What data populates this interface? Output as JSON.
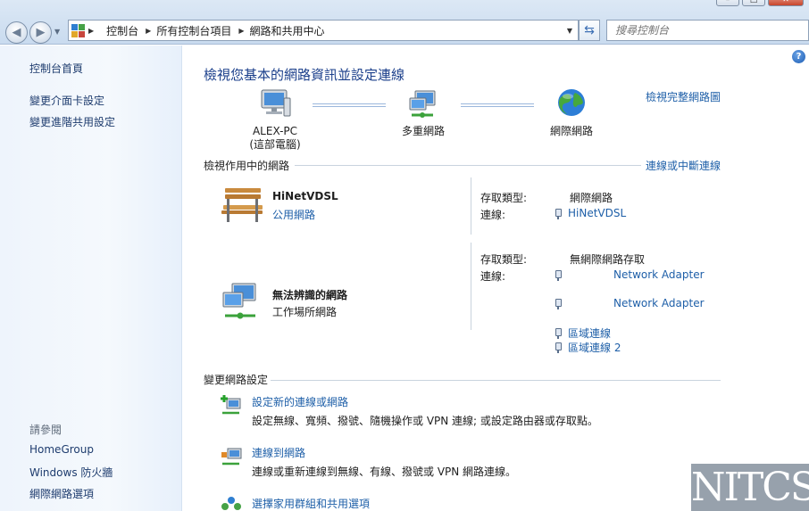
{
  "window": {
    "controls": [
      "–",
      "□",
      "✕"
    ]
  },
  "nav": {
    "back_icon": "back-arrow-icon",
    "forward_icon": "forward-arrow-icon"
  },
  "address": {
    "crumbs": [
      "控制台",
      "所有控制台項目",
      "網路和共用中心"
    ]
  },
  "search": {
    "placeholder": "搜尋控制台"
  },
  "sidebar": {
    "home": "控制台首頁",
    "items": [
      "變更介面卡設定",
      "變更進階共用設定"
    ],
    "see_also_label": "請參閱",
    "see_also": [
      "HomeGroup",
      "Windows 防火牆",
      "網際網路選項"
    ]
  },
  "main": {
    "title": "檢視您基本的網路資訊並設定連線",
    "view_full_map": "檢視完整網路圖",
    "map": {
      "computer": {
        "name": "ALEX-PC",
        "sub": "(這部電腦)"
      },
      "middle": {
        "name": "多重網路"
      },
      "internet": {
        "name": "網際網路"
      }
    },
    "active_section": {
      "heading": "檢視作用中的網路",
      "action": "連線或中斷連線"
    },
    "networks": [
      {
        "name": "HiNetVDSL",
        "type": "公用網路",
        "access_label": "存取類型:",
        "access_value": "網際網路",
        "conn_label": "連線:",
        "connections": [
          "HiNetVDSL"
        ]
      },
      {
        "name": "無法辨識的網路",
        "type": "工作場所網路",
        "access_label": "存取類型:",
        "access_value": "無網際網路存取",
        "conn_label": "連線:",
        "connections": [
          "Network Adapter",
          "Network Adapter",
          "區域連線",
          "區域連線 2"
        ]
      }
    ],
    "change_section": {
      "heading": "變更網路設定",
      "tasks": [
        {
          "title": "設定新的連線或網路",
          "desc": "設定無線、寬頻、撥號、隨機操作或 VPN 連線; 或設定路由器或存取點。"
        },
        {
          "title": "連線到網路",
          "desc": "連線或重新連線到無線、有線、撥號或 VPN 網路連線。"
        },
        {
          "title": "選擇家用群組和共用選項",
          "desc": ""
        }
      ]
    }
  },
  "watermark": "NITCS",
  "colors": {
    "link": "#1e5fa8",
    "title": "#1b3f8b",
    "sidebar_bg": "#eef4fc"
  }
}
